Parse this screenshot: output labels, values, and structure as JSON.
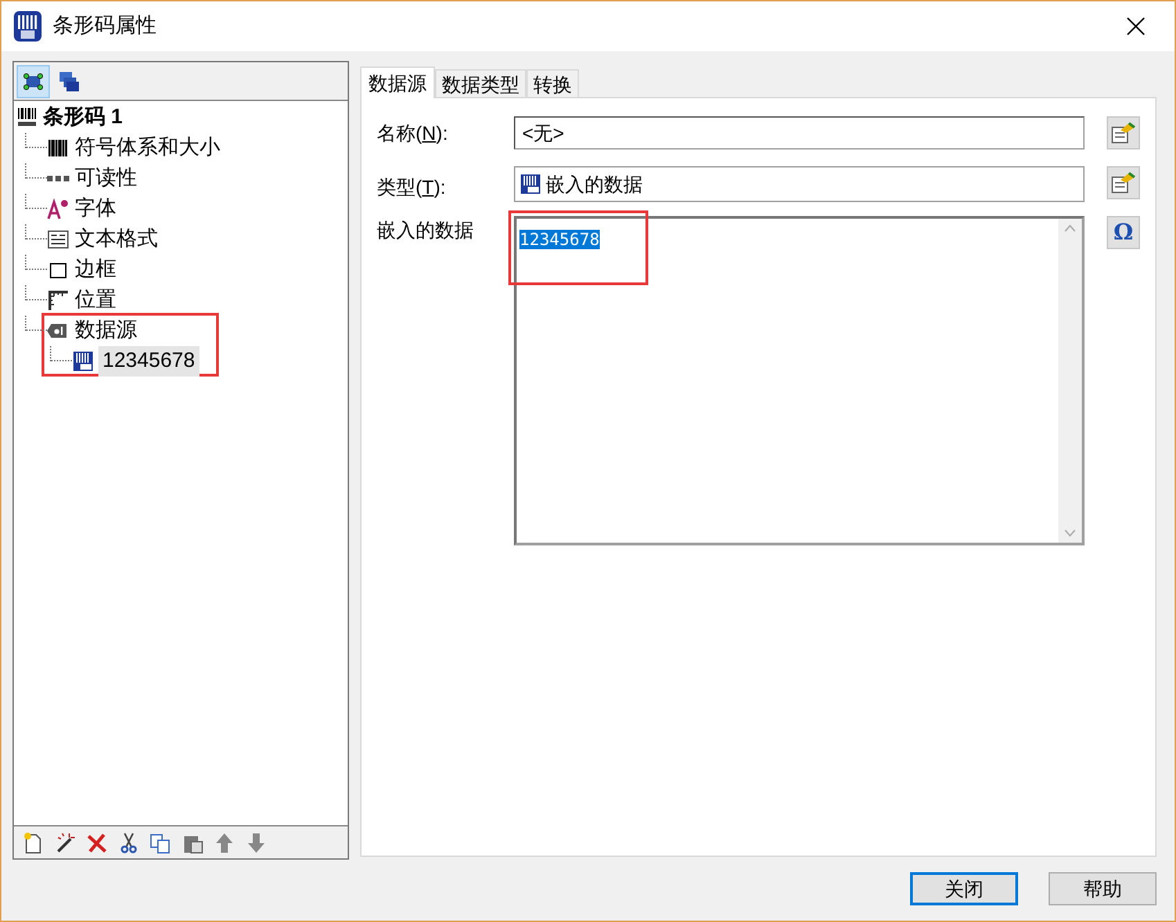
{
  "window": {
    "title": "条形码属性"
  },
  "tree": {
    "toolbar_top": [
      {
        "selected": true
      },
      {
        "selected": false
      }
    ],
    "root": {
      "label": "条形码 1",
      "kind": "barcode",
      "children": [
        {
          "label": "符号体系和大小",
          "kind": "symbology",
          "selected": false,
          "highlighted": false
        },
        {
          "label": "可读性",
          "kind": "readability",
          "selected": false,
          "highlighted": false
        },
        {
          "label": "字体",
          "kind": "font",
          "selected": false,
          "highlighted": false
        },
        {
          "label": "文本格式",
          "kind": "format",
          "selected": false,
          "highlighted": false
        },
        {
          "label": "边框",
          "kind": "border",
          "selected": false,
          "highlighted": false
        },
        {
          "label": "位置",
          "kind": "position",
          "selected": false,
          "highlighted": false
        },
        {
          "label": "数据源",
          "kind": "source",
          "selected": false,
          "highlighted": true,
          "children": [
            {
              "label": "12345678",
              "kind": "embedded",
              "selected": true,
              "highlighted": false
            }
          ]
        }
      ]
    }
  },
  "tabs": [
    {
      "label": "数据源",
      "selected": true
    },
    {
      "label": "数据类型",
      "selected": false
    },
    {
      "label": "转换",
      "selected": false
    }
  ],
  "form": {
    "name_label": "名称(N):",
    "name_value": "<无>",
    "type_label": "类型(T):",
    "type_value": "嵌入的数据",
    "data_label": "嵌入的数据",
    "data_value": "12345678",
    "data_selected": true,
    "data_highlighted": true,
    "symbol_button": "Ω"
  },
  "buttons": [
    "关闭",
    "帮助"
  ]
}
